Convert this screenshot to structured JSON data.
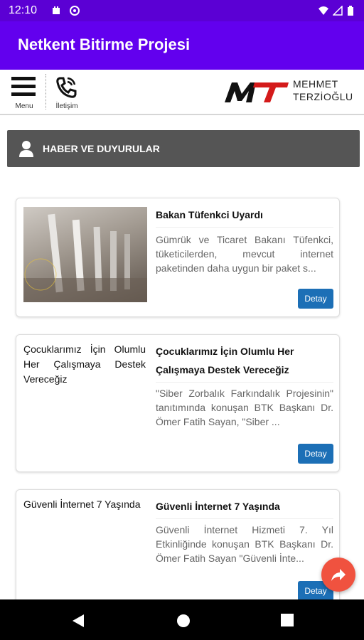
{
  "status_bar": {
    "time": "12:10"
  },
  "app_bar": {
    "title": "Netkent Bitirme Projesi"
  },
  "toolbar": {
    "menu_label": "Menu",
    "contact_label": "İletişim"
  },
  "logo": {
    "line1": "MEHMET",
    "line2": "TERZİOĞLU"
  },
  "section": {
    "title": "HABER VE DUYURULAR"
  },
  "news": [
    {
      "title": "Bakan Tüfenkci Uyardı",
      "excerpt": "Gümrük ve Ticaret Bakanı Tüfenkci, tüketicilerden, mevcut internet paketinden daha uygun bir paket s...",
      "button": "Detay"
    },
    {
      "left_text": "Çocuklarımız İçin Olumlu Her Çalışmaya Destek Vereceğiz",
      "title": "Çocuklarımız İçin Olumlu Her Çalışmaya Destek Vereceğiz",
      "excerpt": "\"Siber Zorbalık Farkındalık Projesinin\" tanıtımında konuşan BTK Başkanı Dr. Ömer Fatih Sayan, \"Siber ...",
      "button": "Detay"
    },
    {
      "left_text": "Güvenli İnternet 7 Yaşında",
      "title": "Güvenli İnternet 7 Yaşında",
      "excerpt": "Güvenli İnternet Hizmeti 7. Yıl Etkinliğinde konuşan BTK Başkanı Dr. Ömer Fatih Sayan \"Güvenli İnte...",
      "button": "Detay"
    }
  ],
  "colors": {
    "status_bar": "#5b00d4",
    "app_bar": "#6200ee",
    "button": "#1c6fb6",
    "fab": "#f0523f",
    "section_bar": "#555555"
  }
}
